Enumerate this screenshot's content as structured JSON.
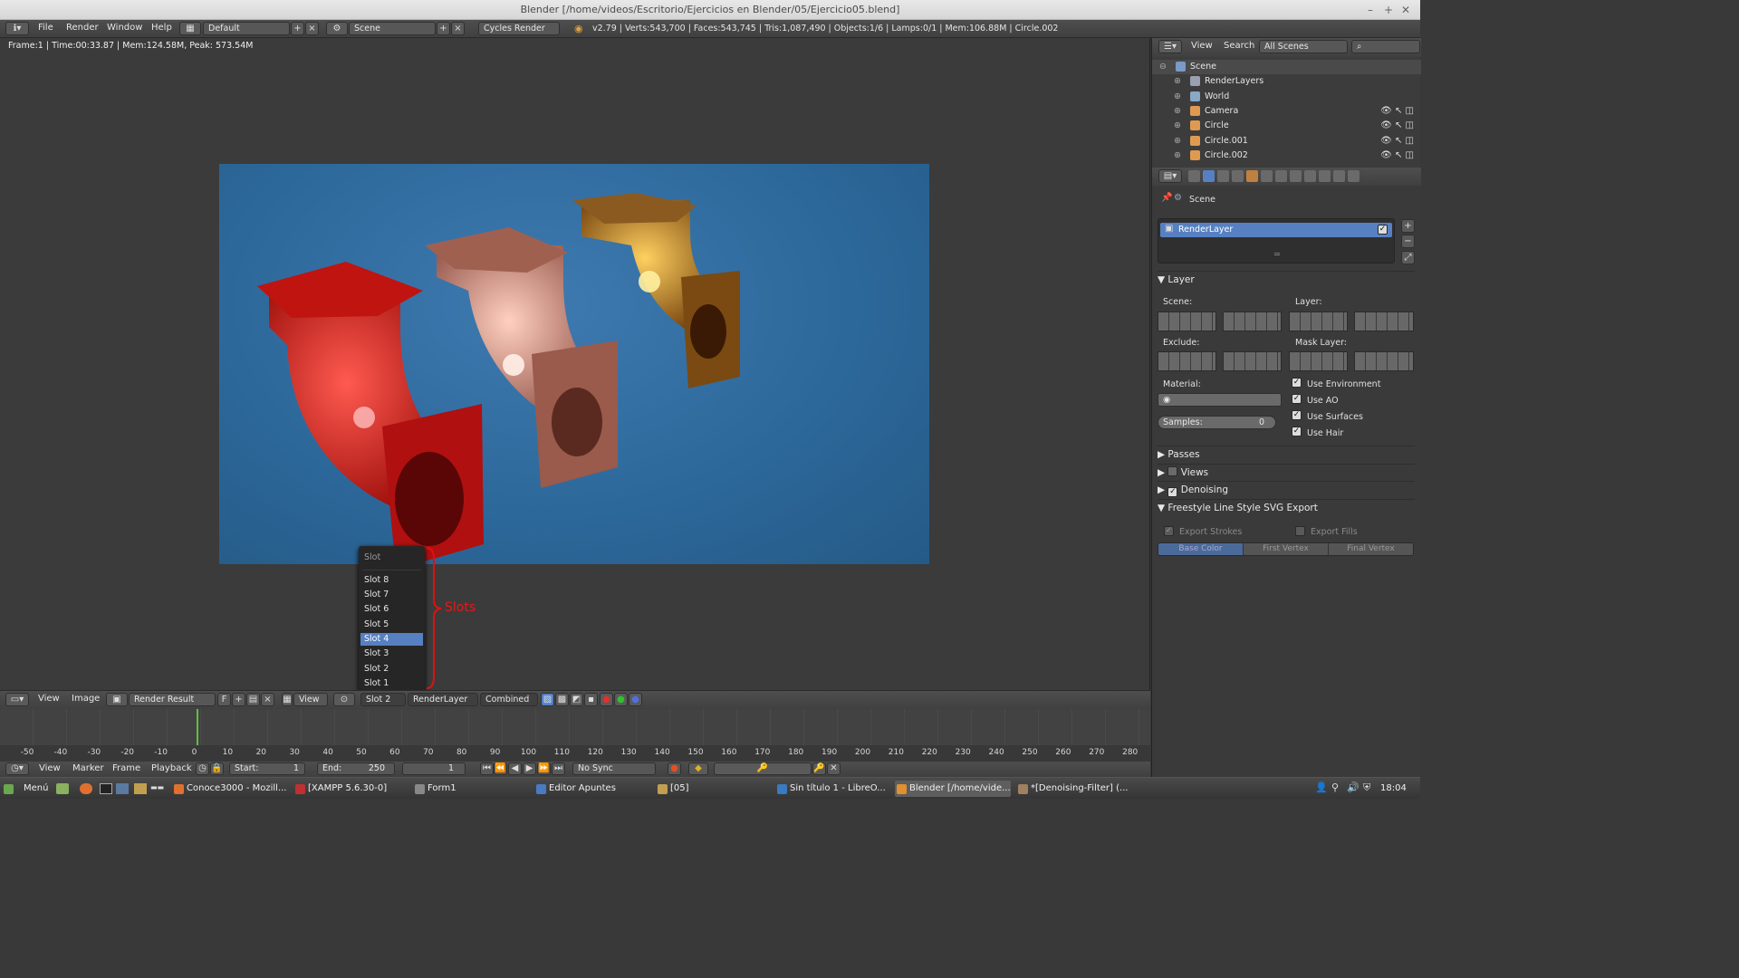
{
  "window": {
    "title": "Blender [/home/videos/Escritorio/Ejercicios en Blender/05/Ejercicio05.blend]",
    "minimize": "–",
    "maximize": "+",
    "close": "✕"
  },
  "topbar": {
    "menus": [
      "File",
      "Render",
      "Window",
      "Help"
    ],
    "layout": "Default",
    "scene": "Scene",
    "engine": "Cycles Render",
    "stats": "v2.79 | Verts:543,700 | Faces:543,745 | Tris:1,087,490 | Objects:1/6 | Lamps:0/1 | Mem:106.88M | Circle.002"
  },
  "viewport": {
    "frame_info": "Frame:1 | Time:00:33.87 | Mem:124.58M, Peak: 573.54M",
    "annotation": "Slots"
  },
  "slot_menu": {
    "title": "Slot",
    "items": [
      "Slot 8",
      "Slot 7",
      "Slot 6",
      "Slot 5",
      "Slot 4",
      "Slot 3",
      "Slot 2",
      "Slot 1"
    ],
    "selected": "Slot 4"
  },
  "image_header": {
    "menus": [
      "View",
      "Image"
    ],
    "image_name": "Render Result",
    "fake_user": "F",
    "view": "View",
    "slot": "Slot 2",
    "layer": "RenderLayer",
    "pass": "Combined"
  },
  "timeline": {
    "ticks": [
      "-50",
      "-40",
      "-30",
      "-20",
      "-10",
      "0",
      "10",
      "20",
      "30",
      "40",
      "50",
      "60",
      "70",
      "80",
      "90",
      "100",
      "110",
      "120",
      "130",
      "140",
      "150",
      "160",
      "170",
      "180",
      "190",
      "200",
      "210",
      "220",
      "230",
      "240",
      "250",
      "260",
      "270",
      "280"
    ],
    "menus": [
      "View",
      "Marker",
      "Frame",
      "Playback"
    ],
    "start_label": "Start:",
    "start": "1",
    "end_label": "End:",
    "end": "250",
    "current": "1",
    "sync": "No Sync"
  },
  "outliner": {
    "menus": [
      "View",
      "Search"
    ],
    "filter": "All Scenes",
    "rows": [
      {
        "label": "Scene",
        "indent": 0,
        "color": "#7a9ac8"
      },
      {
        "label": "RenderLayers",
        "indent": 1,
        "color": "#9aa0b0"
      },
      {
        "label": "World",
        "indent": 1,
        "color": "#8aa8c8"
      },
      {
        "label": "Camera",
        "indent": 1,
        "color": "#e09a50"
      },
      {
        "label": "Circle",
        "indent": 1,
        "color": "#e09a50"
      },
      {
        "label": "Circle.001",
        "indent": 1,
        "color": "#e09a50"
      },
      {
        "label": "Circle.002",
        "indent": 1,
        "color": "#e09a50"
      }
    ]
  },
  "properties": {
    "context": "Scene",
    "render_layer": "RenderLayer",
    "layer_panel": "Layer",
    "scene_label": "Scene:",
    "layer_label": "Layer:",
    "exclude_label": "Exclude:",
    "mask_label": "Mask Layer:",
    "material_label": "Material:",
    "samples_label": "Samples:",
    "samples": "0",
    "options": [
      "Use Environment",
      "Use AO",
      "Use Surfaces",
      "Use Hair"
    ],
    "panels": [
      "Passes",
      "Views",
      "Denoising",
      "Freestyle Line Style SVG Export"
    ],
    "export_strokes": "Export Strokes",
    "export_fills": "Export Fills",
    "color_modes": [
      "Base Color",
      "First Vertex",
      "Final Vertex"
    ]
  },
  "taskbar": {
    "start": "Menú",
    "tasks": [
      "Conoce3000 - Mozill...",
      "[XAMPP 5.6.30-0]",
      "Form1",
      "Editor Apuntes",
      "[05]",
      "Sin título 1 - LibreO...",
      "Blender [/home/vide...",
      "*[Denoising-Filter] (..."
    ],
    "clock": "18:04"
  }
}
